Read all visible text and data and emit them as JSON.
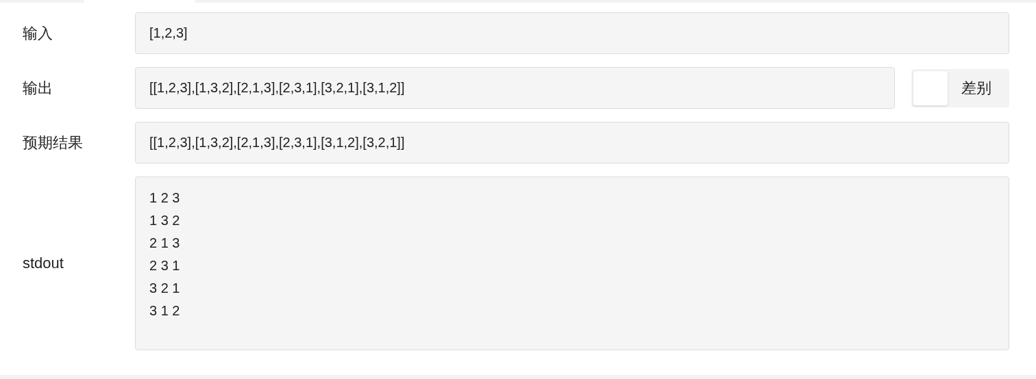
{
  "rows": [
    {
      "label": "输入",
      "value": "[1,2,3]",
      "kind": "line"
    },
    {
      "label": "输出",
      "value": "[[1,2,3],[1,3,2],[2,1,3],[2,3,1],[3,2,1],[3,1,2]]",
      "kind": "line",
      "diff_toggle": {
        "label": "差别",
        "on": false
      }
    },
    {
      "label": "预期结果",
      "value": "[[1,2,3],[1,3,2],[2,1,3],[2,3,1],[3,1,2],[3,2,1]]",
      "kind": "line"
    },
    {
      "label": "stdout",
      "value": "1 2 3\n1 3 2\n2 1 3\n2 3 1\n3 2 1\n3 1 2",
      "kind": "block"
    }
  ]
}
